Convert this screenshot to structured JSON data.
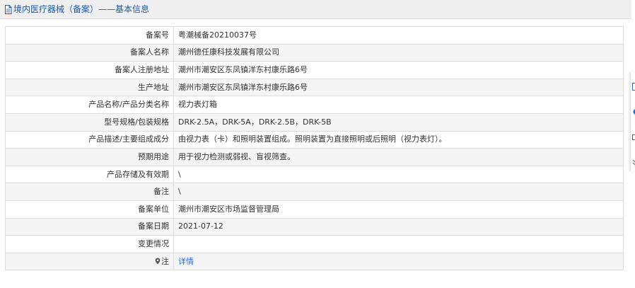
{
  "header": {
    "title": "境内医疗器械（备案）——基本信息"
  },
  "rows": [
    {
      "label": "备案号",
      "value": "粤潮械备20210037号"
    },
    {
      "label": "备案人名称",
      "value": "潮州德任康科技发展有限公司"
    },
    {
      "label": "备案人注册地址",
      "value": "潮州市潮安区东凤镇洋东村康乐路6号"
    },
    {
      "label": "生产地址",
      "value": "潮州市潮安区东凤镇洋东村康乐路6号"
    },
    {
      "label": "产品名称/产品分类名称",
      "value": "视力表灯箱"
    },
    {
      "label": "型号规格/包装规格",
      "value": "DRK-2.5A，DRK-5A，DRK-2.5B，DRK-5B"
    },
    {
      "label": "产品描述/主要组成成分",
      "value": "由视力表（卡）和照明装置组成。照明装置为直接照明或后照明（视力表灯）。"
    },
    {
      "label": "预期用途",
      "value": "用于视力检测或弱视、盲视筛查。"
    },
    {
      "label": "产品存储及有效期",
      "value": "\\"
    },
    {
      "label": "备注",
      "value": "\\"
    },
    {
      "label": "备案单位",
      "value": "潮州市潮安区市场监督管理局"
    },
    {
      "label": "备案日期",
      "value": "2021-07-12"
    },
    {
      "label": "变更情况",
      "value": ""
    }
  ],
  "note_row": {
    "label": "注",
    "link_text": "详情",
    "icon": "map-pin-icon"
  },
  "icons": {
    "header": "document-icon",
    "side": [
      "edit-icon",
      "chat-icon",
      "thumb-icon",
      "expand-icon"
    ]
  },
  "colors": {
    "header_bg": "#efefef",
    "title": "#1e5aa8",
    "link": "#1e6fd9",
    "border": "#dcdcdc",
    "row_alt": "#f5f5f5"
  }
}
